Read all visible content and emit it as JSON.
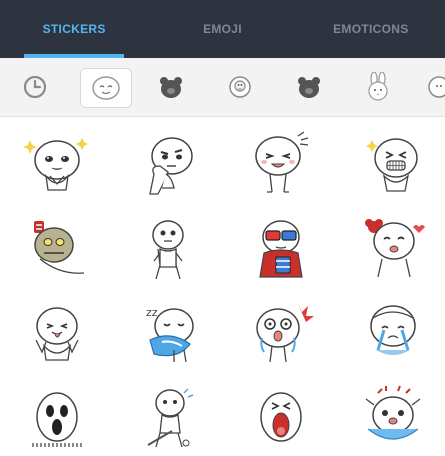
{
  "tabs": [
    {
      "label": "STICKERS",
      "active": true
    },
    {
      "label": "EMOJI",
      "active": false
    },
    {
      "label": "EMOTICONS",
      "active": false
    }
  ],
  "colors": {
    "tabbar_bg": "#2d3440",
    "tab_active": "#53b5f2",
    "tab_inactive": "#7f8794",
    "category_bg": "#f3f3f3"
  },
  "categories": [
    {
      "icon": "recent-clock-icon",
      "selected": false
    },
    {
      "icon": "moon-face-icon",
      "selected": true
    },
    {
      "icon": "brown-bear-icon",
      "selected": false
    },
    {
      "icon": "rabbit-face-icon",
      "selected": false
    },
    {
      "icon": "brown-bear-icon",
      "selected": false
    },
    {
      "icon": "cony-rabbit-icon",
      "selected": false
    },
    {
      "icon": "rabbit-face-icon",
      "selected": false
    }
  ],
  "stickers": [
    {
      "name": "moon-sparkle-sticker"
    },
    {
      "name": "moon-thinking-sticker"
    },
    {
      "name": "moon-laughing-sticker"
    },
    {
      "name": "moon-grin-sticker"
    },
    {
      "name": "moon-robot-sticker"
    },
    {
      "name": "moon-walking-sticker"
    },
    {
      "name": "moon-3d-glasses-sticker"
    },
    {
      "name": "moon-hearts-sticker"
    },
    {
      "name": "moon-tongue-sticker"
    },
    {
      "name": "moon-crying-sticker"
    },
    {
      "name": "moon-shocked-sticker"
    },
    {
      "name": "moon-tears-sticker"
    },
    {
      "name": "moon-scream-sticker"
    },
    {
      "name": "moon-golf-sticker"
    },
    {
      "name": "moon-shouting-sticker"
    },
    {
      "name": "moon-cheering-sticker"
    }
  ]
}
